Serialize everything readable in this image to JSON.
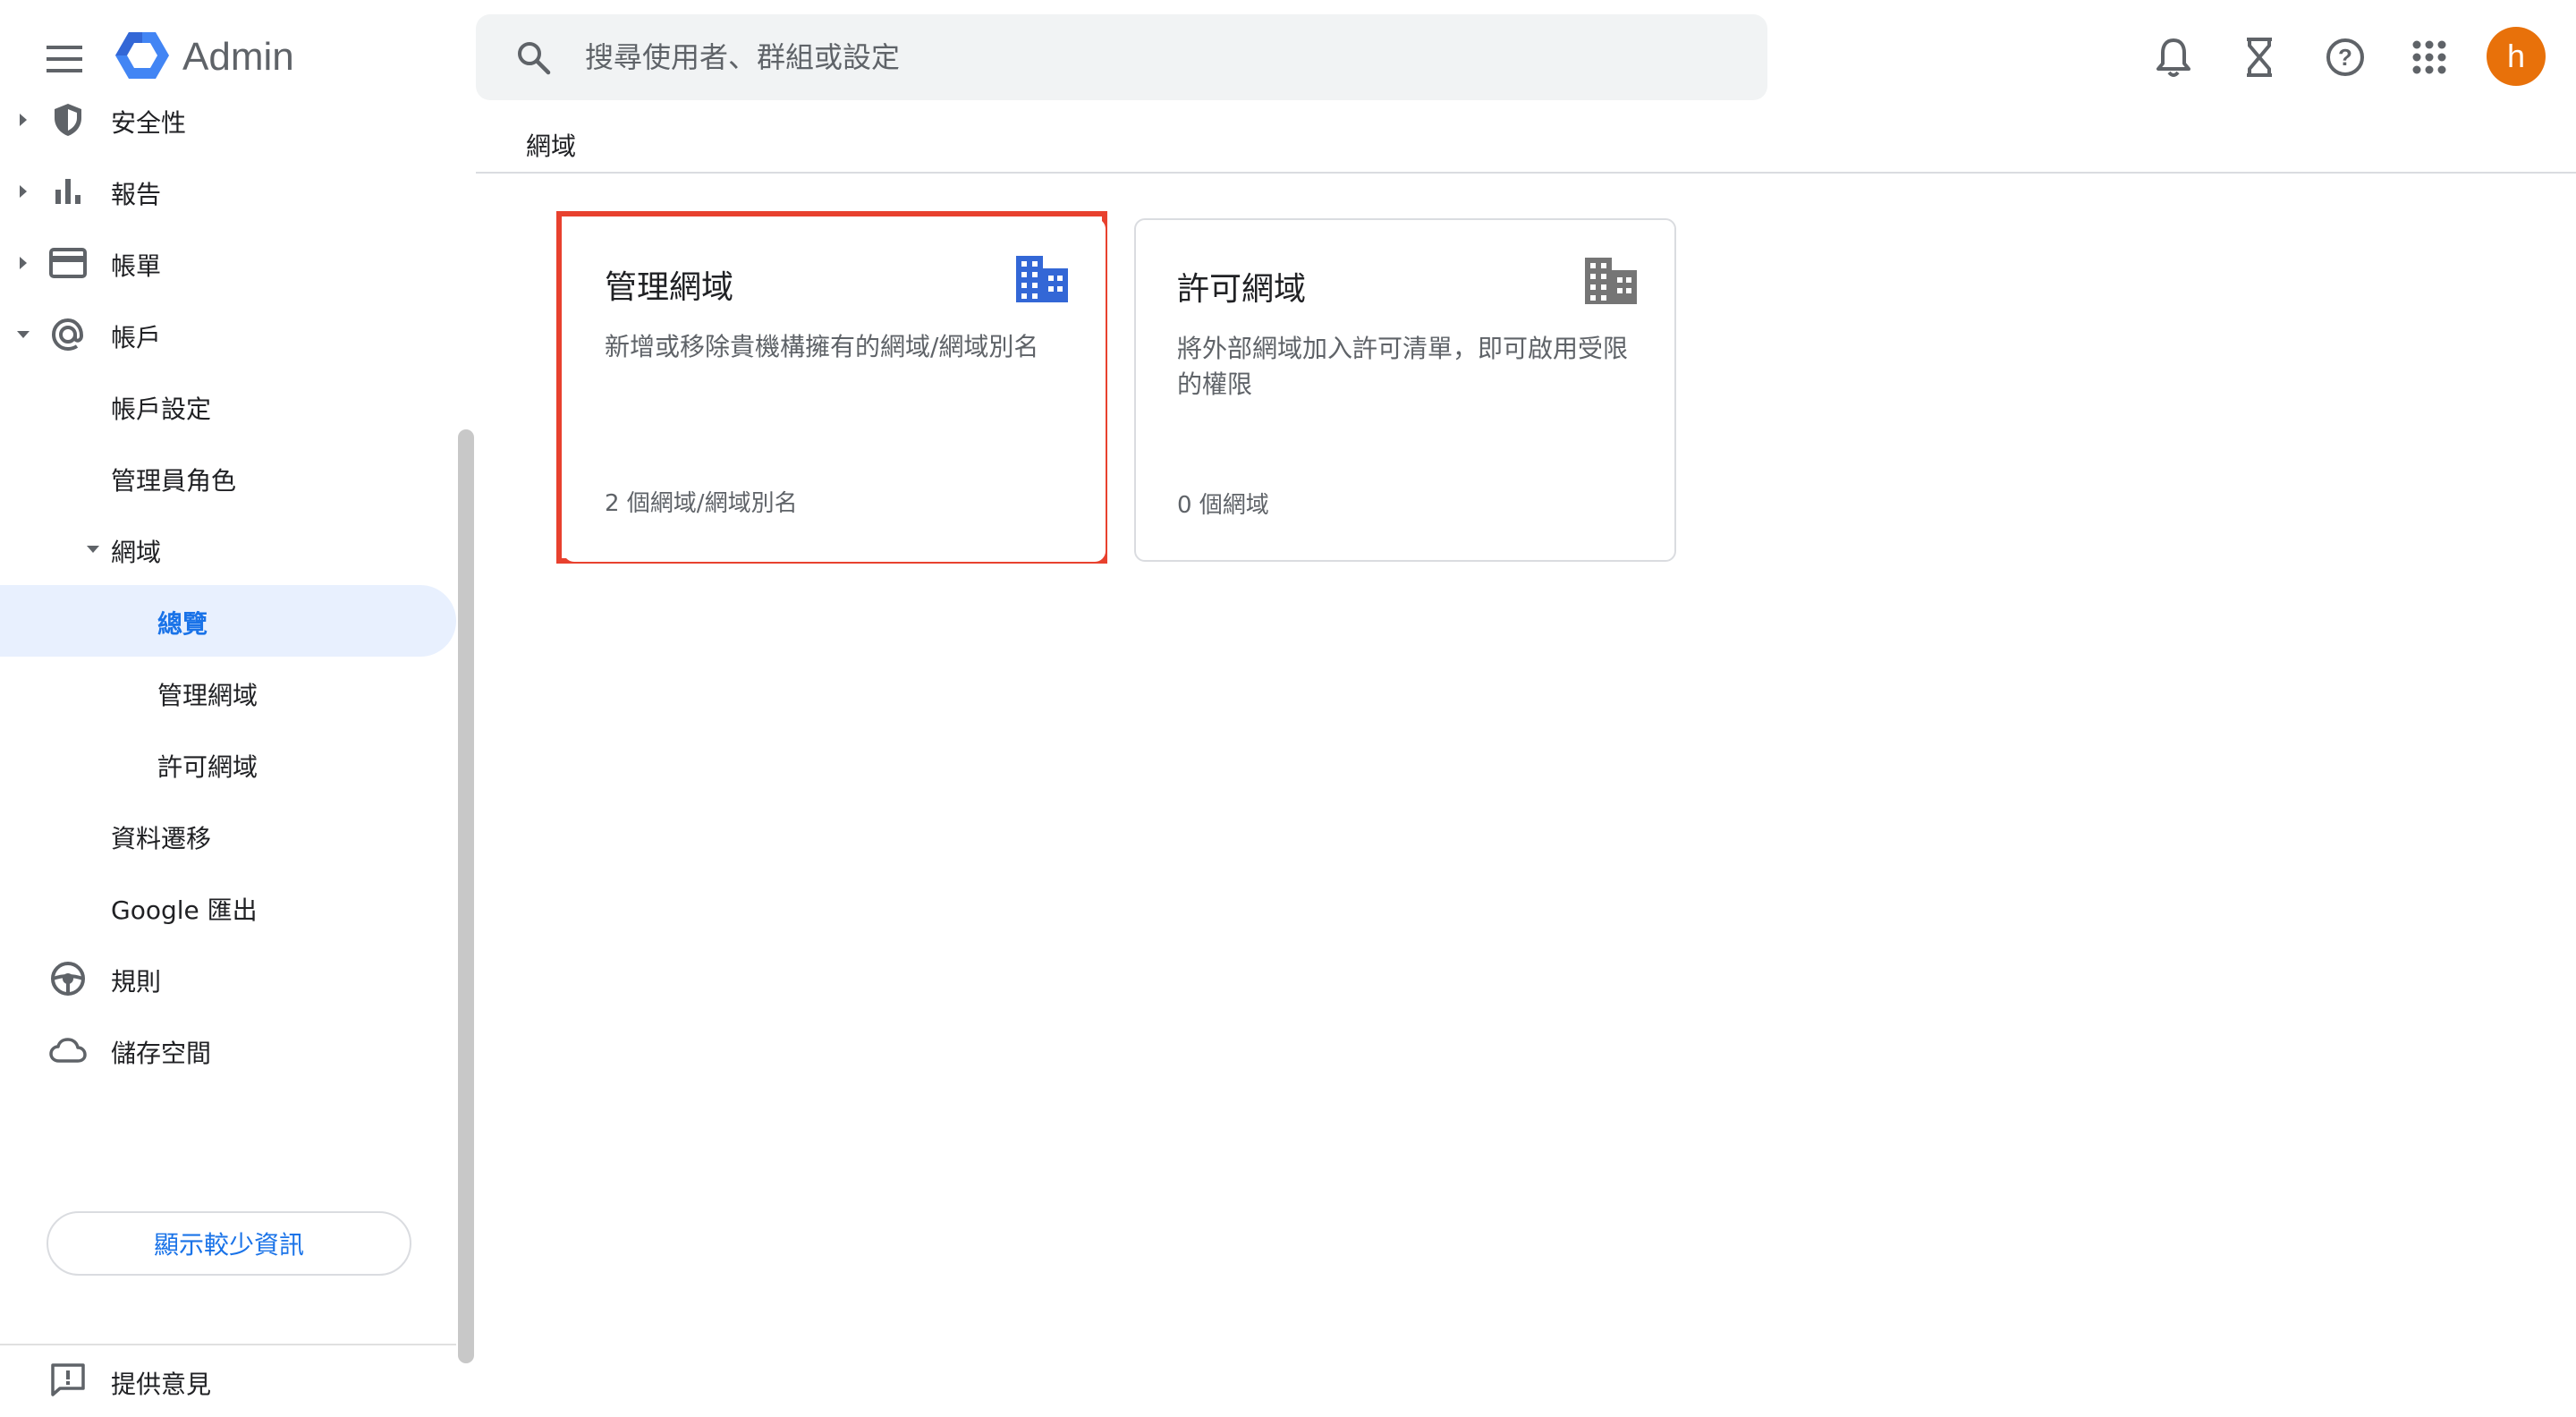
{
  "header": {
    "app_name": "Admin",
    "search_placeholder": "搜尋使用者、群組或設定",
    "avatar_letter": "h",
    "icons": [
      "menu-icon",
      "admin-logo-icon",
      "search-icon",
      "bell-icon",
      "hourglass-icon",
      "help-icon",
      "apps-grid-icon"
    ]
  },
  "sidebar": {
    "items": [
      {
        "label": "安全性",
        "icon": "shield-icon"
      },
      {
        "label": "報告",
        "icon": "bar-chart-icon"
      },
      {
        "label": "帳單",
        "icon": "credit-card-icon"
      },
      {
        "label": "帳戶",
        "icon": "at-sign-icon"
      },
      {
        "label": "帳戶設定"
      },
      {
        "label": "管理員角色"
      },
      {
        "label": "網域"
      },
      {
        "label": "總覽"
      },
      {
        "label": "管理網域"
      },
      {
        "label": "許可網域"
      },
      {
        "label": "資料遷移"
      },
      {
        "label": "Google 匯出"
      },
      {
        "label": "規則",
        "icon": "steering-wheel-icon"
      },
      {
        "label": "儲存空間",
        "icon": "cloud-icon"
      }
    ],
    "show_less_label": "顯示較少資訊",
    "feedback_label": "提供意見"
  },
  "main": {
    "breadcrumb": "網域",
    "cards": [
      {
        "title": "管理網域",
        "description": "新增或移除貴機構擁有的網域/網域別名",
        "footer": "2 個網域/網域別名",
        "icon": "building-icon",
        "icon_color": "#3367d6"
      },
      {
        "title": "許可網域",
        "description": "將外部網域加入許可清單，即可啟用受限的權限",
        "footer": "0 個網域",
        "icon": "building-icon",
        "icon_color": "#757575"
      }
    ]
  },
  "colors": {
    "accent": "#1a73e8",
    "highlight": "#e8412e",
    "avatar": "#e8710a",
    "selected_bg": "#e8f0fe"
  }
}
